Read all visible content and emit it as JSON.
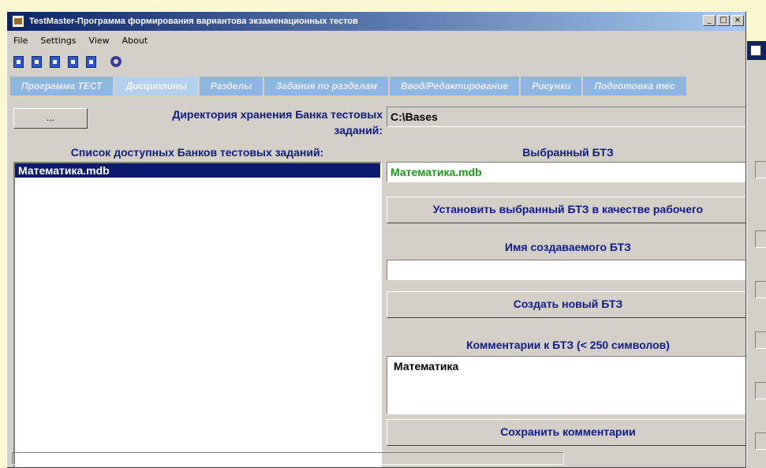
{
  "window": {
    "title": "TestMaster-Программа формирования вариантова экзаменационных тестов",
    "minimize": "_",
    "maximize": "□",
    "close": "×"
  },
  "menu": [
    "File",
    "Settings",
    "View",
    "About"
  ],
  "toolbar": {
    "icons": [
      "doc-blue-icon",
      "doc-blue-icon",
      "doc-blue-icon",
      "doc-blue-icon",
      "doc-blue-icon",
      "settings-gear-icon"
    ]
  },
  "tabs": [
    {
      "label": "Программа ТЕСТ",
      "active": false
    },
    {
      "label": "Дисциплины",
      "active": true
    },
    {
      "label": "Разделы",
      "active": false
    },
    {
      "label": "Задания по разделам",
      "active": false
    },
    {
      "label": "Ввод/Редактирование",
      "active": false
    },
    {
      "label": "Рисунки",
      "active": false
    },
    {
      "label": "Подготовка тес",
      "active": false
    }
  ],
  "directory": {
    "browse_label": "...",
    "label": "Директория хранения Банка тестовых заданий:",
    "value": "C:\\Bases"
  },
  "banks": {
    "heading": "Список доступных Банков тестовых заданий:",
    "items": [
      "Математика.mdb"
    ]
  },
  "selected": {
    "label": "Выбранный БТЗ",
    "value": "Математика.mdb",
    "value_color": "#1a9a1a",
    "set_button": "Установить выбранный БТЗ в качестве рабочего"
  },
  "create": {
    "label": "Имя создаваемого БТЗ",
    "value": "",
    "button": "Создать новый БТЗ"
  },
  "comments": {
    "label": "Комментарии к БТЗ  (< 250 символов)",
    "value": "Математика",
    "button": "Сохранить комментарии"
  },
  "colors": {
    "accent_text": "#0e1a8a",
    "tab_bg": "#8eb6e2",
    "selection": "#0a1a6e",
    "desktop": "#fbf8cf"
  }
}
